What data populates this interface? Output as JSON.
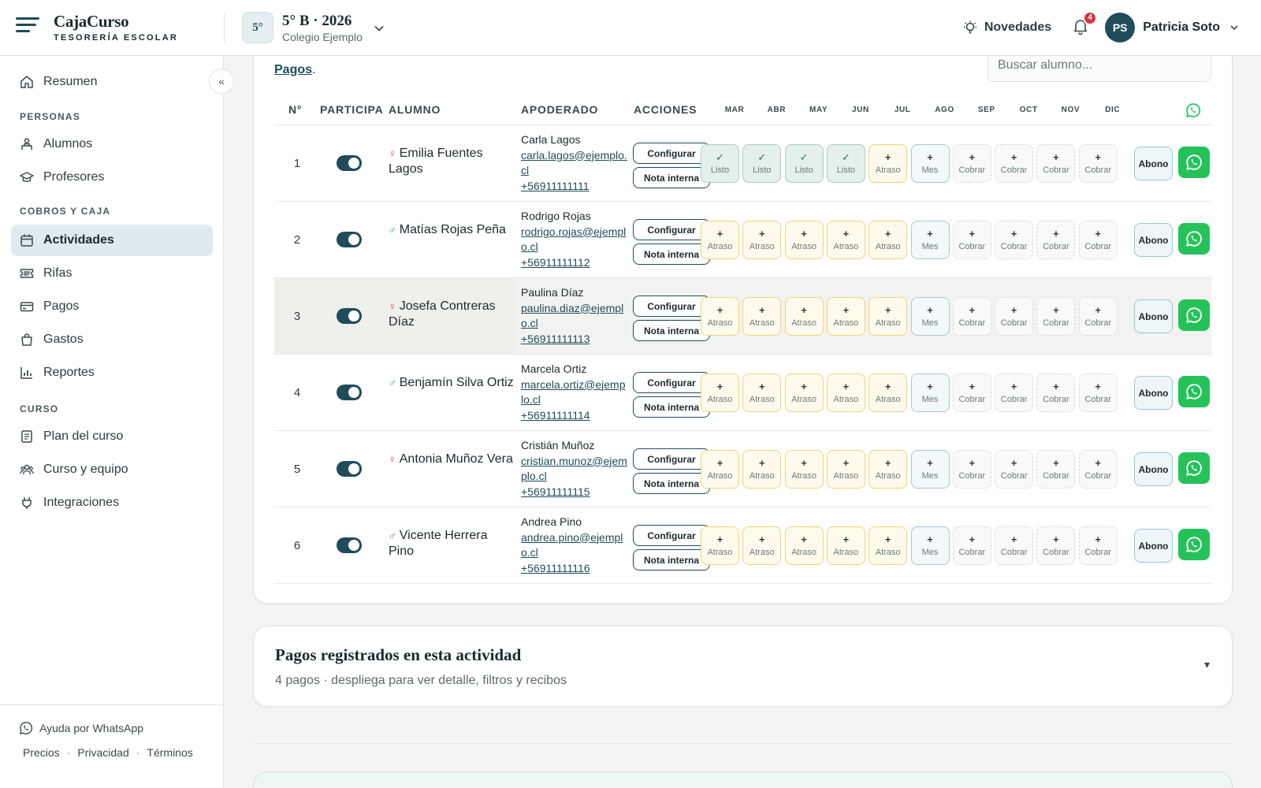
{
  "app": {
    "name": "CajaCurso",
    "subtitle": "TESORERÍA ESCOLAR"
  },
  "course": {
    "badge": "5°",
    "title": "5° B · 2026",
    "school": "Colegio Ejemplo"
  },
  "header": {
    "news_label": "Novedades",
    "notifications_count": "4",
    "user_initials": "PS",
    "user_name": "Patricia Soto"
  },
  "sidebar": {
    "items": [
      {
        "label": "Resumen",
        "icon": "home-icon"
      },
      {
        "label": "Alumnos",
        "icon": "student-icon"
      },
      {
        "label": "Profesores",
        "icon": "graduation-cap-icon"
      },
      {
        "label": "Actividades",
        "icon": "calendar-icon",
        "active": true
      },
      {
        "label": "Rifas",
        "icon": "ticket-icon"
      },
      {
        "label": "Pagos",
        "icon": "credit-card-icon"
      },
      {
        "label": "Gastos",
        "icon": "shopping-bag-icon"
      },
      {
        "label": "Reportes",
        "icon": "bar-chart-icon"
      },
      {
        "label": "Plan del curso",
        "icon": "document-icon"
      },
      {
        "label": "Curso y equipo",
        "icon": "users-icon"
      },
      {
        "label": "Integraciones",
        "icon": "plug-icon"
      }
    ],
    "sections": {
      "personas": "PERSONAS",
      "cobros": "COBROS Y CAJA",
      "curso": "CURSO"
    },
    "collapse_symbol": "«",
    "footer": {
      "help": "Ayuda por WhatsApp",
      "links": [
        "Precios",
        "Privacidad",
        "Términos"
      ]
    }
  },
  "main": {
    "intro_link": "Pagos",
    "intro_after": ".",
    "search_placeholder": "Buscar alumno...",
    "table": {
      "headers": {
        "num": "N°",
        "participa": "PARTICIPA",
        "alumno": "ALUMNO",
        "apoderado": "APODERADO",
        "acciones": "ACCIONES"
      },
      "months": [
        "MAR",
        "ABR",
        "MAY",
        "JUN",
        "JUL",
        "AGO",
        "SEP",
        "OCT",
        "NOV",
        "DIC"
      ],
      "buttons": {
        "configure": "Configurar",
        "note": "Nota interna",
        "abono": "Abono"
      },
      "rows": [
        {
          "num": "1",
          "sex": "f",
          "student": "Emilia Fuentes Lagos",
          "guardian": "Carla Lagos",
          "email": "carla.lagos@ejemplo.cl",
          "phone": "+56911111111",
          "months": [
            "Listo",
            "Listo",
            "Listo",
            "Listo",
            "Atraso",
            "Mes",
            "Cobrar",
            "Cobrar",
            "Cobrar",
            "Cobrar"
          ]
        },
        {
          "num": "2",
          "sex": "m",
          "student": "Matías Rojas Peña",
          "guardian": "Rodrigo Rojas",
          "email": "rodrigo.rojas@ejemplo.cl",
          "phone": "+56911111112",
          "months": [
            "Atraso",
            "Atraso",
            "Atraso",
            "Atraso",
            "Atraso",
            "Mes",
            "Cobrar",
            "Cobrar",
            "Cobrar",
            "Cobrar"
          ]
        },
        {
          "num": "3",
          "sex": "f",
          "student": "Josefa Contreras Díaz",
          "guardian": "Paulina Díaz",
          "email": "paulina.diaz@ejemplo.cl",
          "phone": "+56911111113",
          "months": [
            "Atraso",
            "Atraso",
            "Atraso",
            "Atraso",
            "Atraso",
            "Mes",
            "Cobrar",
            "Cobrar",
            "Cobrar",
            "Cobrar"
          ],
          "highlight": true
        },
        {
          "num": "4",
          "sex": "m",
          "student": "Benjamín Silva Ortiz",
          "guardian": "Marcela Ortiz",
          "email": "marcela.ortiz@ejemplo.cl",
          "phone": "+56911111114",
          "months": [
            "Atraso",
            "Atraso",
            "Atraso",
            "Atraso",
            "Atraso",
            "Mes",
            "Cobrar",
            "Cobrar",
            "Cobrar",
            "Cobrar"
          ]
        },
        {
          "num": "5",
          "sex": "f",
          "student": "Antonia Muñoz Vera",
          "guardian": "Cristián Muñoz",
          "email": "cristian.munoz@ejemplo.cl",
          "phone": "+56911111115",
          "months": [
            "Atraso",
            "Atraso",
            "Atraso",
            "Atraso",
            "Atraso",
            "Mes",
            "Cobrar",
            "Cobrar",
            "Cobrar",
            "Cobrar"
          ]
        },
        {
          "num": "6",
          "sex": "m",
          "student": "Vicente Herrera Pino",
          "guardian": "Andrea Pino",
          "email": "andrea.pino@ejemplo.cl",
          "phone": "+56911111116",
          "months": [
            "Atraso",
            "Atraso",
            "Atraso",
            "Atraso",
            "Atraso",
            "Mes",
            "Cobrar",
            "Cobrar",
            "Cobrar",
            "Cobrar"
          ]
        }
      ]
    },
    "payments": {
      "title": "Pagos registrados en esta actividad",
      "subtitle": "4 pagos · despliega para ver detalle, filtros y recibos",
      "caret": "▾"
    }
  },
  "colors": {
    "primary": "#1f4c5a",
    "active_nav": "#ddebef",
    "whatsapp": "#25c25a",
    "late": "#f1d37c",
    "paid": "#a9cfc3",
    "notification": "#d9333f"
  }
}
